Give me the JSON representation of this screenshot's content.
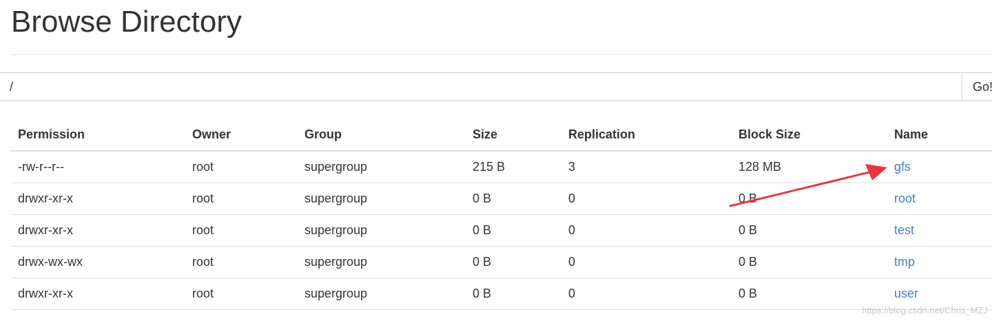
{
  "header": {
    "title": "Browse Directory"
  },
  "path_bar": {
    "value": "/",
    "go_label": "Go!"
  },
  "table": {
    "columns": [
      "Permission",
      "Owner",
      "Group",
      "Size",
      "Replication",
      "Block Size",
      "Name"
    ],
    "rows": [
      {
        "permission": "-rw-r--r--",
        "owner": "root",
        "group": "supergroup",
        "size": "215 B",
        "replication": "3",
        "block_size": "128 MB",
        "name": "gfs"
      },
      {
        "permission": "drwxr-xr-x",
        "owner": "root",
        "group": "supergroup",
        "size": "0 B",
        "replication": "0",
        "block_size": "0 B",
        "name": "root"
      },
      {
        "permission": "drwxr-xr-x",
        "owner": "root",
        "group": "supergroup",
        "size": "0 B",
        "replication": "0",
        "block_size": "0 B",
        "name": "test"
      },
      {
        "permission": "drwx-wx-wx",
        "owner": "root",
        "group": "supergroup",
        "size": "0 B",
        "replication": "0",
        "block_size": "0 B",
        "name": "tmp"
      },
      {
        "permission": "drwxr-xr-x",
        "owner": "root",
        "group": "supergroup",
        "size": "0 B",
        "replication": "0",
        "block_size": "0 B",
        "name": "user"
      }
    ]
  },
  "annotation": {
    "arrow_color": "#e8383d"
  },
  "watermark": "https://blog.csdn.net/Chris_MZJ",
  "colors": {
    "link": "#3c7fc7",
    "text": "#333333",
    "border": "#dddddd"
  }
}
